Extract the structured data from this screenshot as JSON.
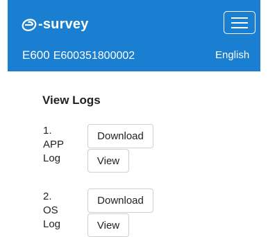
{
  "header": {
    "brand": "-survey",
    "brand_logo_icon": "e-logo-icon",
    "device_model": "E600",
    "device_serial": "E600351800002",
    "language": "English",
    "menu_icon": "hamburger-icon",
    "bg_color": "#1a7fd1"
  },
  "main": {
    "title": "View Logs",
    "logs": [
      {
        "number": "1.",
        "name_line1": "APP",
        "name_line2": "Log",
        "download_label": "Download",
        "view_label": "View"
      },
      {
        "number": "2.",
        "name_line1": "OS",
        "name_line2": "Log",
        "download_label": "Download",
        "view_label": "View"
      }
    ]
  }
}
